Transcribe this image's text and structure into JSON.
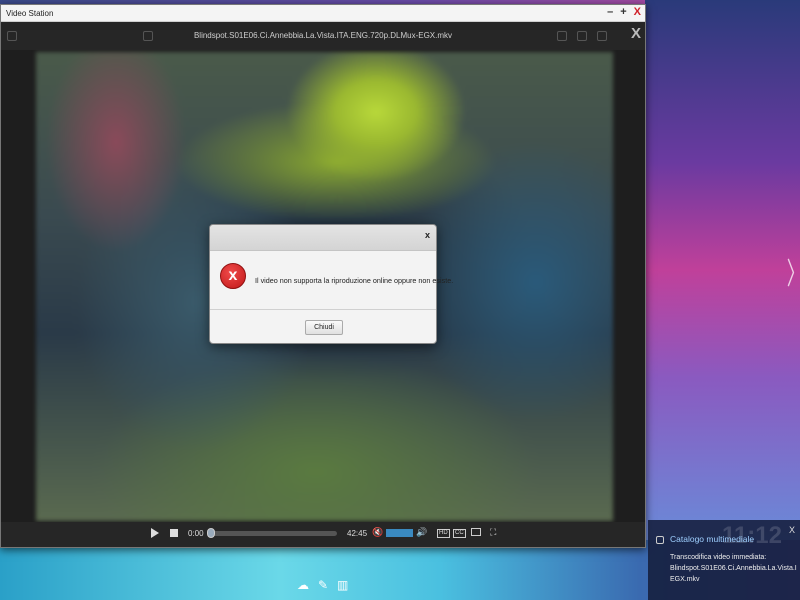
{
  "window": {
    "title": "Video Station",
    "controls": {
      "minimize": "–",
      "maximize": "+",
      "close": "X"
    }
  },
  "player": {
    "filename": "Blindspot.S01E06.Ci.Annebbia.La.Vista.ITA.ENG.720p.DLMux-EGX.mkv",
    "close_label": "X",
    "controls": {
      "time_current": "0:00",
      "time_total": "42:45",
      "progress": 0,
      "hd_label": "HD",
      "cc_label": "CC",
      "mute_icon": "🔇",
      "volume_icon": "🔊",
      "fullscreen_icon": "⛶"
    }
  },
  "dialog": {
    "close_label": "x",
    "icon": "x",
    "message": "Il video non supporta la riproduzione online oppure non esiste.",
    "button_label": "Chiudi"
  },
  "notification": {
    "title": "Catalogo multimediale",
    "close_label": "X",
    "clock": "11:12",
    "line1": "Transcodifica video immediata:",
    "line2": "Blindspot.S01E06.Ci.Annebbia.La.Vista.I",
    "line3": "EGX.mkv"
  },
  "desktop": {
    "next_arrow": "〉",
    "dock_icons": [
      "☁",
      "✎",
      "▥"
    ]
  },
  "colors": {
    "accent": "#3a8ac0",
    "close_red": "#d0202a",
    "error_red": "#d02020"
  }
}
